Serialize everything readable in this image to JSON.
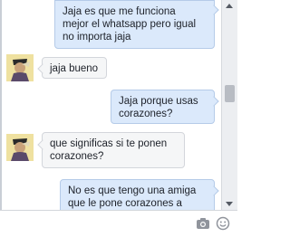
{
  "messages": [
    {
      "side": "out",
      "lines": [
        "Jaja es que me funciona",
        "mejor el whatsapp pero igual",
        "no importa jaja"
      ]
    },
    {
      "side": "in",
      "lines": [
        "jaja bueno"
      ]
    },
    {
      "side": "out",
      "lines": [
        "Jaja porque usas",
        "corazones?"
      ]
    },
    {
      "side": "in",
      "lines": [
        "que significas si te ponen",
        "corazones?"
      ]
    },
    {
      "side": "out",
      "lines": [
        "No es que tengo una amiga",
        "que le pone corazones a"
      ]
    }
  ],
  "composer": {
    "placeholder": ""
  },
  "icons": {
    "camera": "camera-icon",
    "emoji": "emoji-icon"
  },
  "colors": {
    "outgoing_bubble": "#dbe9fb",
    "incoming_bubble": "#f5f6f7"
  }
}
